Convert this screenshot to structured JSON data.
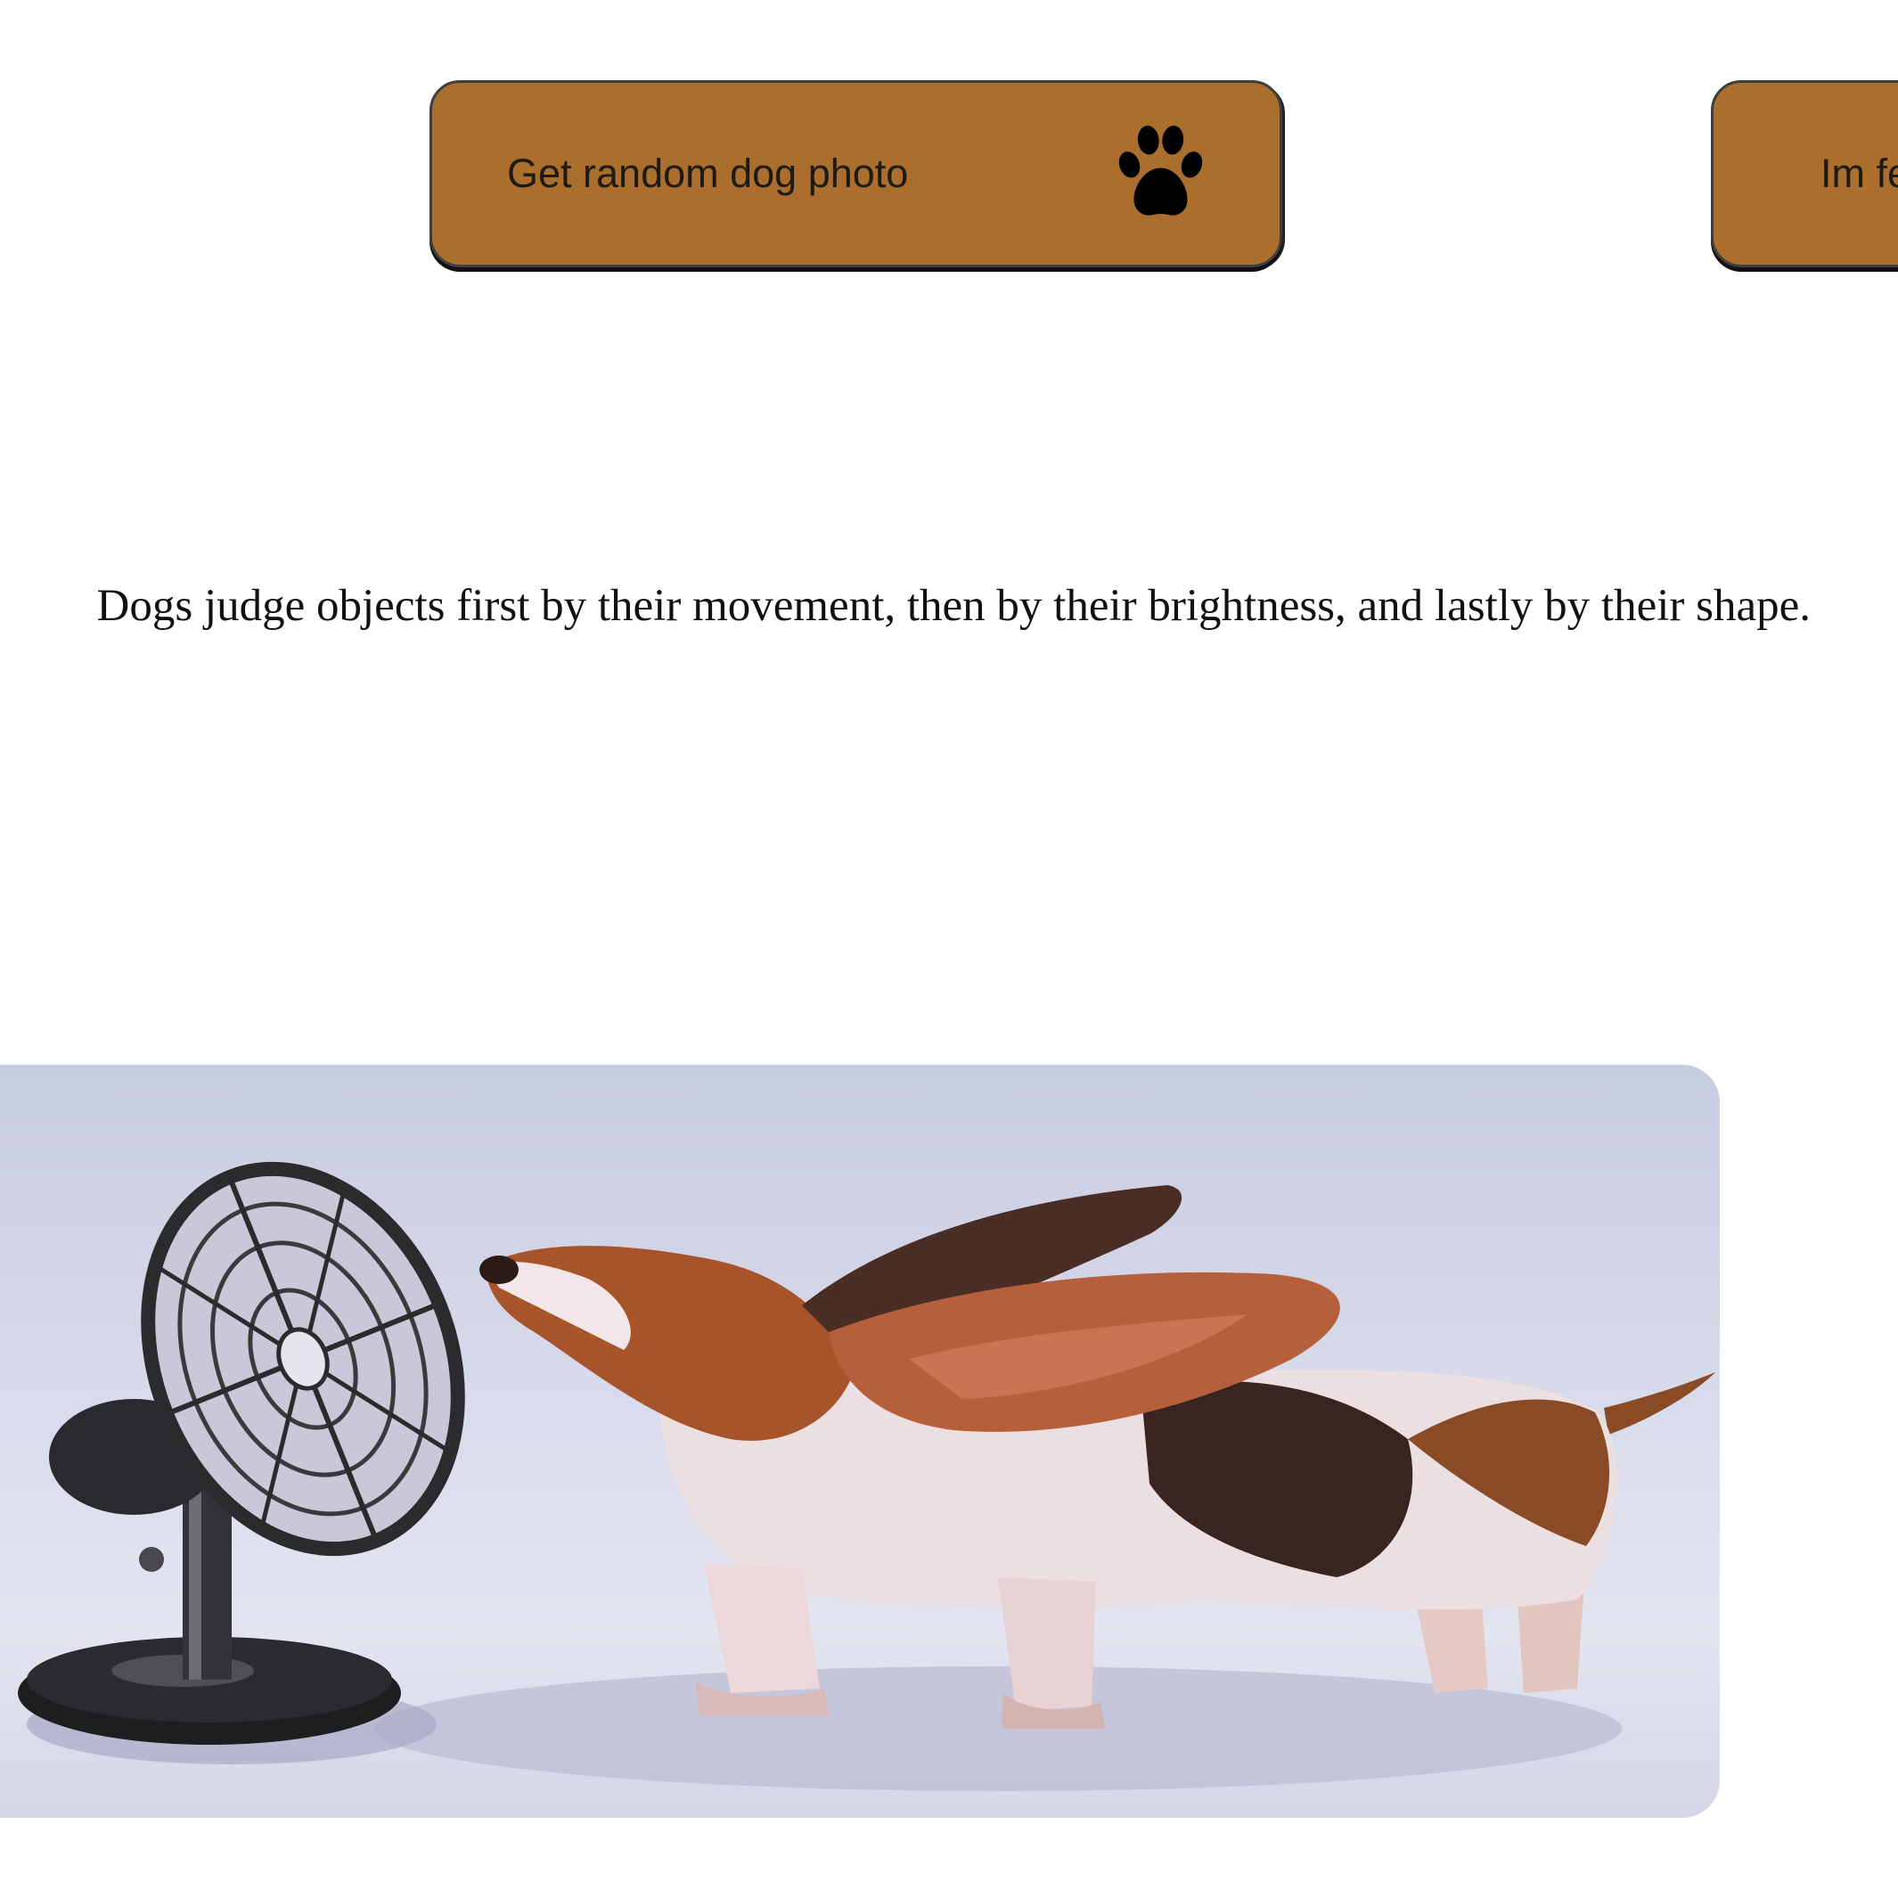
{
  "buttons": {
    "dog_photo": {
      "label": "Get random dog photo",
      "icon": "paw-icon"
    },
    "lucky": {
      "label": "Im feeling lucky"
    }
  },
  "fact": {
    "text": "Dogs judge objects first by their movement, then by their brightness, and lastly by their shape."
  },
  "colors": {
    "button_fill": "#ab6e2c",
    "button_border": "#3f3f3f"
  }
}
